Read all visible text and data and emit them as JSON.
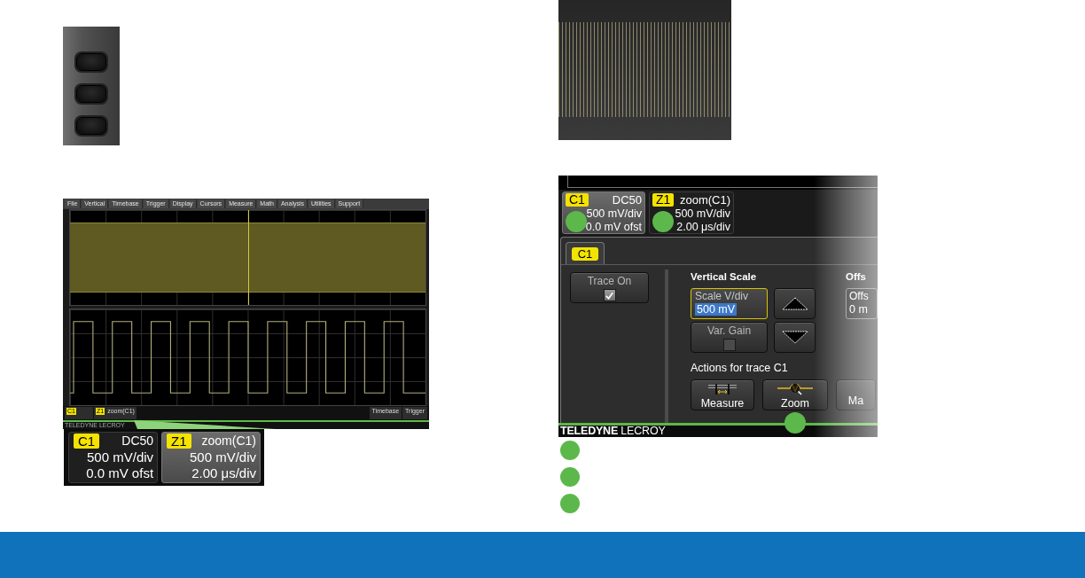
{
  "scope_screen": {
    "menu": [
      "File",
      "Vertical",
      "Timebase",
      "Trigger",
      "Display",
      "Cursors",
      "Measure",
      "Math",
      "Analysis",
      "Utilities",
      "Support"
    ],
    "descriptors": [
      {
        "tag": "C1"
      },
      {
        "tag": "Z1",
        "title": "zoom(C1)"
      }
    ],
    "status": [
      "Timebase",
      "Trigger"
    ],
    "brand": "TELEDYNE LECROY"
  },
  "zoom_descriptors": [
    {
      "tag": "C1",
      "title": "DC50",
      "lines": [
        "500 mV/div",
        "0.0 mV ofst"
      ],
      "selected": false
    },
    {
      "tag": "Z1",
      "title": "zoom(C1)",
      "lines": [
        "500 mV/div",
        "2.00 μs/div"
      ],
      "selected": true
    }
  ],
  "dialog_screen": {
    "descriptors": [
      {
        "tag": "C1",
        "title": "DC50",
        "lines": [
          "500 mV/div",
          "0.0 mV ofst"
        ],
        "selected": true,
        "marker": true
      },
      {
        "tag": "Z1",
        "title": "zoom(C1)",
        "lines": [
          "500 mV/div",
          "2.00 μs/div"
        ],
        "selected": false,
        "marker": true
      }
    ],
    "tabs": [
      {
        "label": "C1",
        "selected": true
      }
    ],
    "trace_on": {
      "label": "Trace On",
      "checked": true
    },
    "vertical_scale": {
      "heading": "Vertical Scale",
      "field_label": "Scale V/div",
      "value": "500 mV"
    },
    "var_gain": {
      "label": "Var. Gain",
      "checked": false
    },
    "offset": {
      "heading": "Offs",
      "field_label": "Offs",
      "value": "0 m"
    },
    "actions_heading": "Actions for trace C1",
    "actions": [
      {
        "label": "Measure",
        "kind": "measure",
        "marker": false
      },
      {
        "label": "Zoom",
        "kind": "zoom",
        "marker": true
      },
      {
        "label": "Ma",
        "kind": "math",
        "marker": false
      }
    ],
    "brand": "**TELEDYNE** LECROY"
  }
}
